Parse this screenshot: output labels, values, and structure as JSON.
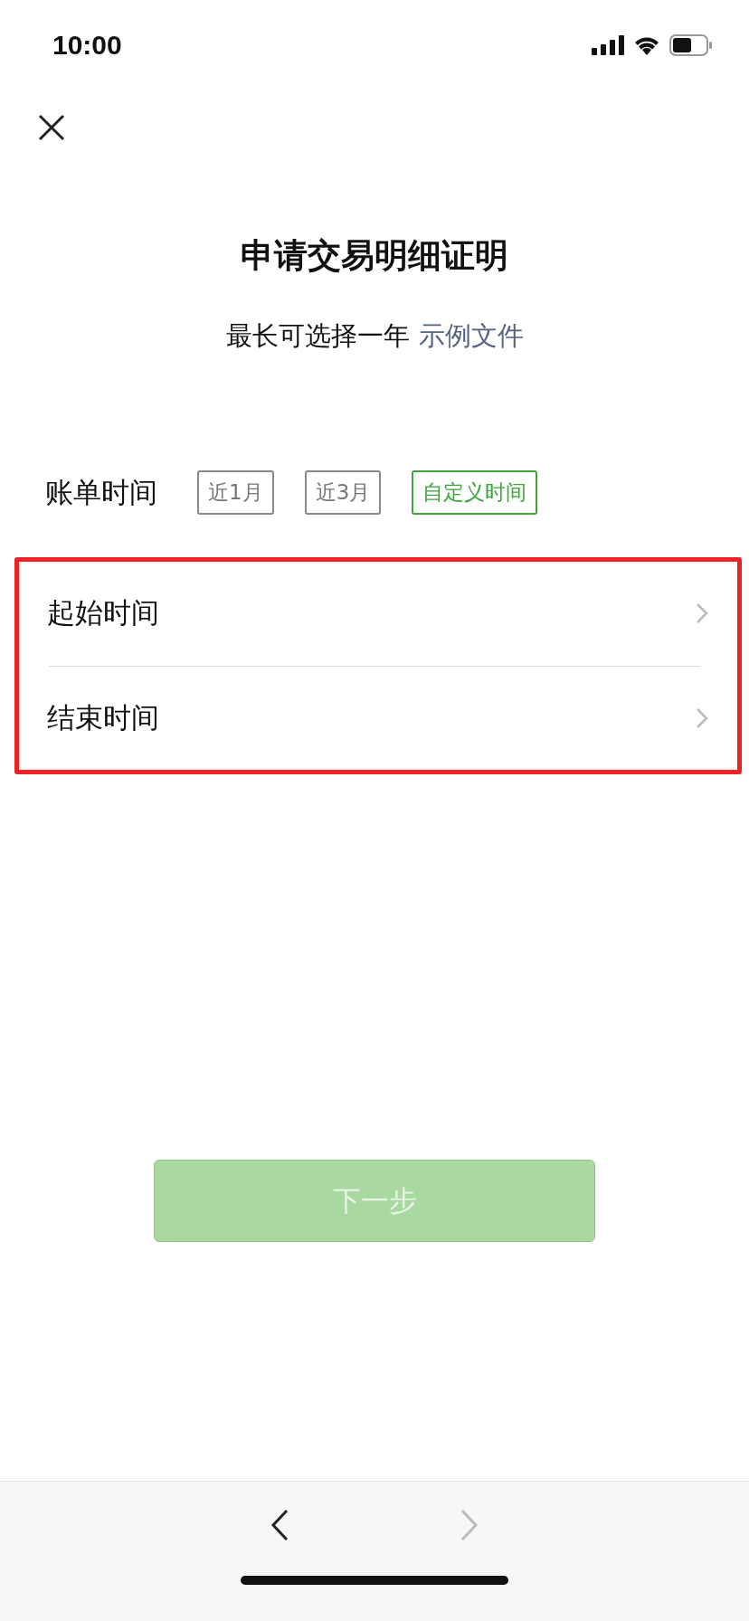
{
  "status_bar": {
    "time": "10:00"
  },
  "title": "申请交易明细证明",
  "subtitle": {
    "text": "最长可选择一年",
    "link": "示例文件"
  },
  "bill_time": {
    "label": "账单时间",
    "options": [
      {
        "label": "近1月",
        "selected": false
      },
      {
        "label": "近3月",
        "selected": false
      },
      {
        "label": "自定义时间",
        "selected": true
      }
    ]
  },
  "date_rows": [
    {
      "label": "起始时间"
    },
    {
      "label": "结束时间"
    }
  ],
  "next_button": {
    "label": "下一步",
    "disabled": true
  },
  "bottom_nav": {
    "back_disabled": false,
    "forward_disabled": true
  }
}
